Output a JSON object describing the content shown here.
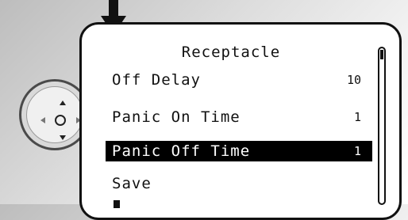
{
  "screen": {
    "title": "Receptacle",
    "menu": [
      {
        "label": "Off Delay",
        "value": "10",
        "selected": false
      },
      {
        "label": "Panic On Time",
        "value": "1",
        "selected": false
      },
      {
        "label": "Panic Off Time",
        "value": "1",
        "selected": true
      },
      {
        "label": "Save",
        "value": "",
        "selected": false
      }
    ]
  },
  "scrollbar": {
    "position": 0.0
  },
  "icons": {
    "pointer": "down-arrow-icon",
    "nav_pad": "directional-pad-icon"
  },
  "colors": {
    "selection_background": "#000000",
    "selection_text": "#ffffff",
    "screen_background": "#ffffff"
  }
}
